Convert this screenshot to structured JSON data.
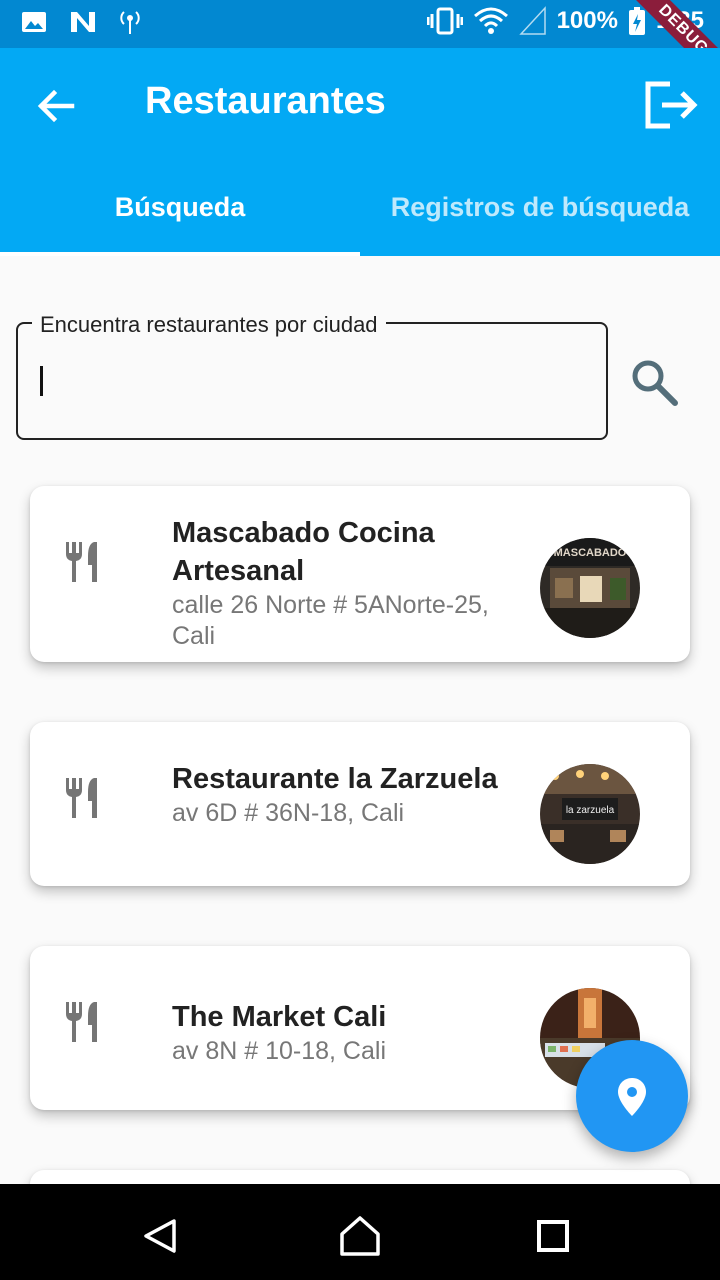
{
  "status_bar": {
    "battery": "100%",
    "time": "1:35",
    "debug_label": "DEBUG"
  },
  "app_bar": {
    "title": "Restaurantes",
    "tabs": [
      {
        "label": "Búsqueda",
        "active": true
      },
      {
        "label": "Registros de búsqueda",
        "active": false
      }
    ]
  },
  "search": {
    "label": "Encuentra restaurantes por ciudad",
    "value": ""
  },
  "restaurants": [
    {
      "name": "Mascabado Cocina Artesanal",
      "address": "calle 26 Norte # 5ANorte-25, Cali",
      "photo_text": "MASCABADO"
    },
    {
      "name": "Restaurante la Zarzuela",
      "address": "av 6D # 36N-18, Cali",
      "photo_text": "la zarzuela"
    },
    {
      "name": "The Market Cali",
      "address": "av 8N # 10-18, Cali",
      "photo_text": ""
    }
  ],
  "colors": {
    "status_bar": "#0288d1",
    "app_bar": "#03a9f4",
    "fab": "#2196f3"
  }
}
